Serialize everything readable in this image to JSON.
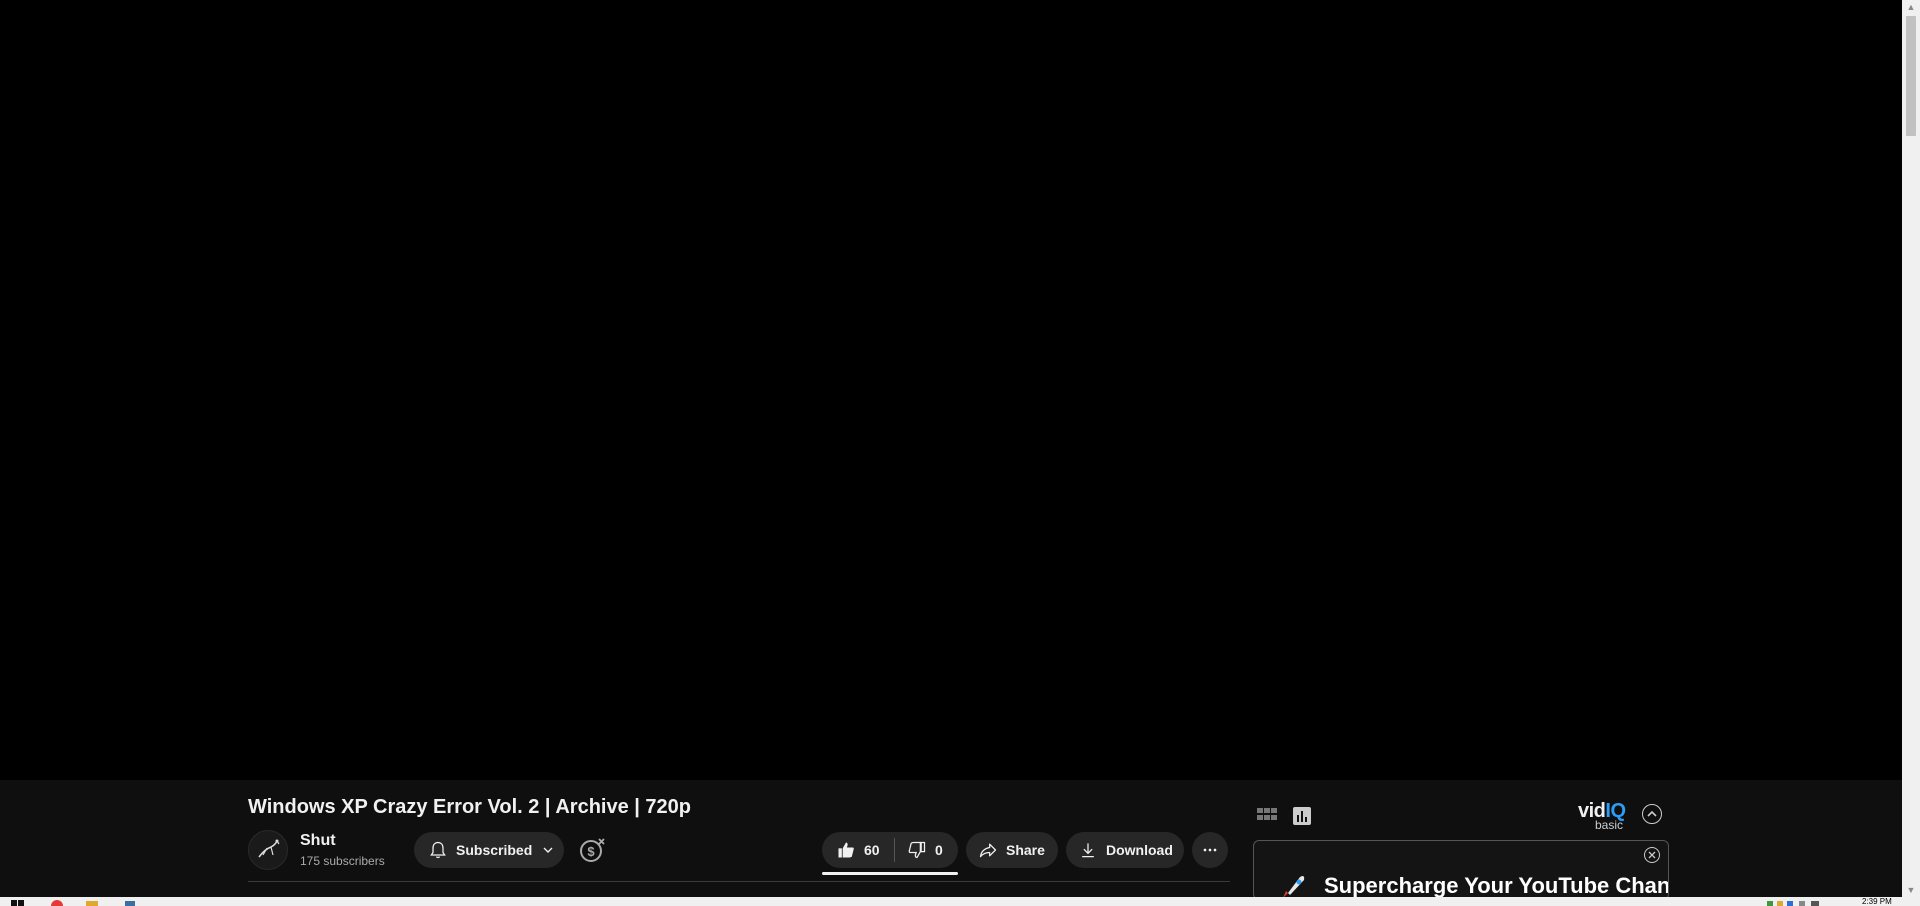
{
  "video": {
    "title": "Windows XP Crazy Error Vol. 2 | Archive | 720p"
  },
  "channel": {
    "name": "Shut",
    "subscribers": "175 subscribers",
    "subscribe_label": "Subscribed"
  },
  "actions": {
    "like_count": "60",
    "dislike_count": "0",
    "share_label": "Share",
    "download_label": "Download"
  },
  "vidiq": {
    "logo_text": "vid",
    "logo_accent": "IQ",
    "plan": "basic",
    "card_headline": "Supercharge Your YouTube Channel"
  },
  "taskbar": {
    "clock": "2:39 PM"
  },
  "colors": {
    "background": "#0f0f0f",
    "video": "#000000",
    "pill": "#272727",
    "vidiq_accent": "#2c9cf5"
  }
}
